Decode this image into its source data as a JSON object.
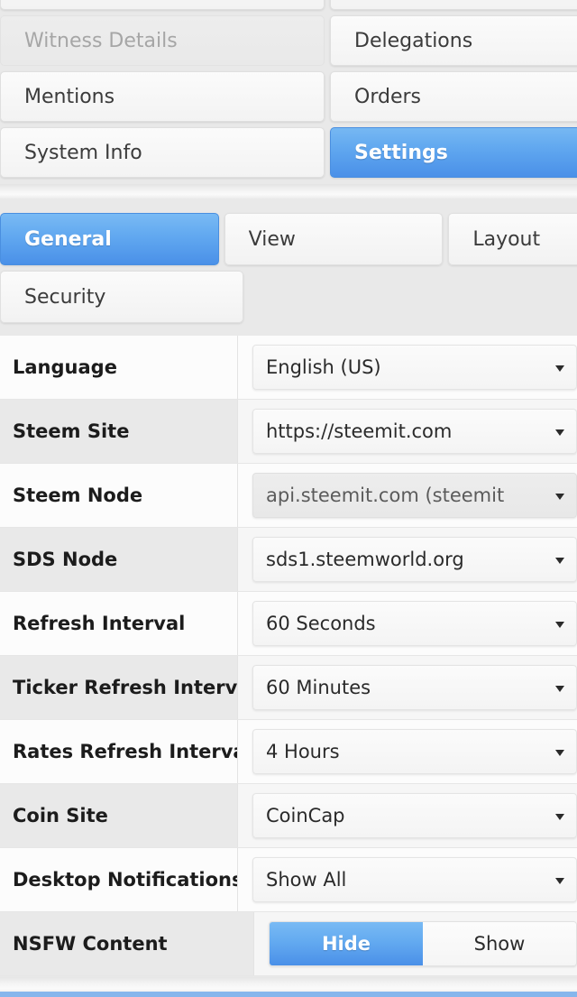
{
  "nav": {
    "rows": [
      [
        {
          "label": "",
          "state": "normal"
        },
        {
          "label": "",
          "state": "normal"
        }
      ],
      [
        {
          "label": "Witness Details",
          "state": "disabled"
        },
        {
          "label": "Delegations",
          "state": "normal"
        }
      ],
      [
        {
          "label": "Mentions",
          "state": "normal"
        },
        {
          "label": "Orders",
          "state": "normal"
        }
      ],
      [
        {
          "label": "System Info",
          "state": "normal"
        },
        {
          "label": "Settings",
          "state": "active"
        }
      ]
    ]
  },
  "tabs": {
    "rows": [
      [
        {
          "label": "General",
          "state": "active"
        },
        {
          "label": "View",
          "state": "normal"
        },
        {
          "label": "Layout",
          "state": "normal"
        }
      ],
      [
        {
          "label": "Security",
          "state": "normal"
        }
      ]
    ]
  },
  "settings": {
    "rows": [
      {
        "label": "Language",
        "control": "select",
        "value": "English (US)",
        "muted": false
      },
      {
        "label": "Steem Site",
        "control": "select",
        "value": "https://steemit.com",
        "muted": false
      },
      {
        "label": "Steem Node",
        "control": "select",
        "value": "api.steemit.com (steemit",
        "muted": true
      },
      {
        "label": "SDS Node",
        "control": "select",
        "value": "sds1.steemworld.org",
        "muted": false
      },
      {
        "label": "Refresh Interval",
        "control": "select",
        "value": "60 Seconds",
        "muted": false
      },
      {
        "label": "Ticker Refresh Interval",
        "control": "select",
        "value": "60 Minutes",
        "muted": false
      },
      {
        "label": "Rates Refresh Interval",
        "control": "select",
        "value": "4 Hours",
        "muted": false
      },
      {
        "label": "Coin Site",
        "control": "select",
        "value": "CoinCap",
        "muted": false
      },
      {
        "label": "Desktop Notifications",
        "control": "select",
        "value": "Show All",
        "muted": false
      },
      {
        "label": "NSFW Content",
        "control": "segmented",
        "options": [
          {
            "label": "Hide",
            "selected": true
          },
          {
            "label": "Show",
            "selected": false
          }
        ]
      }
    ]
  },
  "colors": {
    "accent": "#4a90e8",
    "accent_light": "#79baf4",
    "footer_bar": "#86b6ec",
    "row_alt": "#e9e9e9",
    "text": "#1c1c1c",
    "text_muted": "#a6a6a6"
  }
}
